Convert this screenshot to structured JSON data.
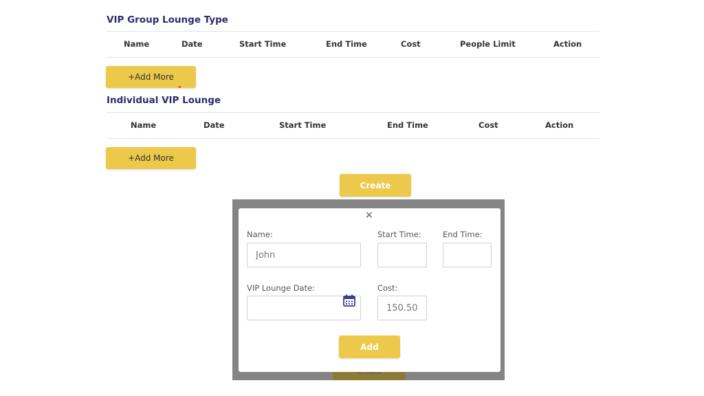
{
  "vip_group": {
    "title": "VIP Group Lounge Type",
    "columns": [
      "Name",
      "Date",
      "Start Time",
      "End Time",
      "Cost",
      "People Limit",
      "Action"
    ],
    "add_more_label": "+Add More"
  },
  "individual_vip": {
    "title": "Individual VIP Lounge",
    "columns": [
      "Name",
      "Date",
      "Start Time",
      "End Time",
      "Cost",
      "Action"
    ],
    "add_more_label": "+Add More"
  },
  "create_label": "Create",
  "modal": {
    "close_glyph": "×",
    "name_label": "Name:",
    "name_value": "John",
    "start_time_label": "Start Time:",
    "start_time_value": "",
    "end_time_label": "End Time:",
    "end_time_value": "",
    "date_label": "VIP Lounge Date:",
    "date_value": "",
    "date_icon": "calendar-icon",
    "cost_label": "Cost:",
    "cost_value": "150.50",
    "add_label": "Add"
  },
  "colors": {
    "accent_yellow": "#ecc94b",
    "title_navy": "#2c2c6e",
    "backdrop_gray": "#848484"
  }
}
